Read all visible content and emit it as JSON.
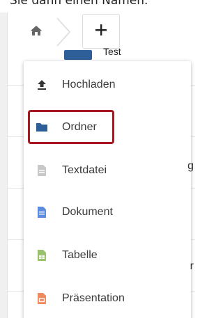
{
  "caption": "Sie dann einen Namen.",
  "breadcrumb": {
    "home_icon": "home-icon",
    "new_icon": "plus-icon"
  },
  "background_file": {
    "name": "Test"
  },
  "menu": {
    "items": [
      {
        "label": "Hochladen",
        "icon": "upload-icon",
        "color": "#333333"
      },
      {
        "label": "Ordner",
        "icon": "folder-icon",
        "color": "#2f5f98"
      },
      {
        "label": "Textdatei",
        "icon": "text-file-icon",
        "color": "#c8c8c8"
      },
      {
        "label": "Dokument",
        "icon": "document-icon",
        "color": "#5b8ce0"
      },
      {
        "label": "Tabelle",
        "icon": "spreadsheet-icon",
        "color": "#9ac16d"
      },
      {
        "label": "Präsentation",
        "icon": "presentation-icon",
        "color": "#ef8a5f"
      }
    ],
    "highlighted_item": "Ordner",
    "highlight_color": "#a5191e"
  }
}
